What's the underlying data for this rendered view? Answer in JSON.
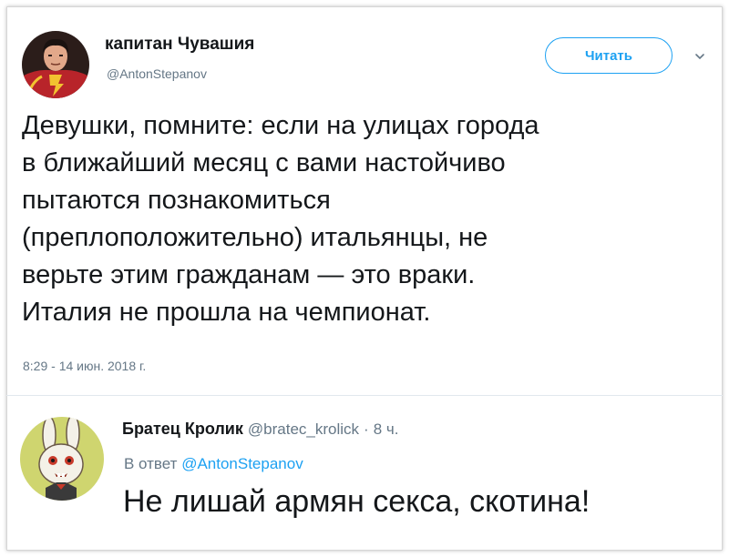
{
  "tweet": {
    "author_name": "капитан Чувашия",
    "author_handle": "@AntonStepanov",
    "follow_label": "Читать",
    "text_lines": [
      "Девушки, помните: если на улицах города",
      "в ближайший месяц с вами настойчиво",
      "пытаются познакомиться",
      "(преплоположительно) итальянцы, не",
      "верьте этим гражданам — это враки.",
      "Италия не прошла на чемпионат."
    ],
    "timestamp": "8:29 - 14 июн. 2018 г."
  },
  "reply": {
    "author_name": "Братец Кролик",
    "author_handle": "@bratec_krolick",
    "separator": "·",
    "time_ago": "8 ч.",
    "in_reply_prefix": "В ответ",
    "in_reply_handle": "@AntonStepanov",
    "text": "Не лишай армян секса, скотина!"
  },
  "icons": {
    "avatar1": "superhero-avatar",
    "avatar2": "rabbit-avatar",
    "chevron": "chevron-down-icon"
  },
  "colors": {
    "accent": "#1da1f2",
    "secondary_text": "#657786",
    "primary_text": "#14171a"
  }
}
